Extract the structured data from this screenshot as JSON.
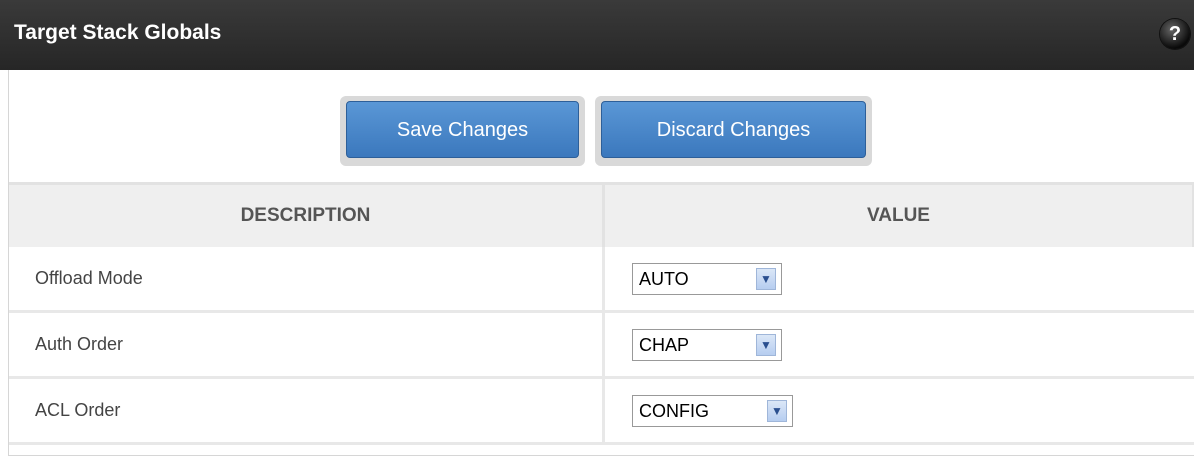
{
  "header": {
    "title": "Target Stack Globals",
    "help_icon": "question-mark-icon",
    "help_glyph": "?"
  },
  "toolbar": {
    "save_label": "Save Changes",
    "discard_label": "Discard Changes"
  },
  "table": {
    "columns": [
      "DESCRIPTION",
      "VALUE"
    ],
    "rows": [
      {
        "description": "Offload Mode",
        "value": "AUTO"
      },
      {
        "description": "Auth Order",
        "value": "CHAP"
      },
      {
        "description": "ACL Order",
        "value": "CONFIG"
      }
    ]
  },
  "colors": {
    "titlebar": "#2e2e2e",
    "button": "#4a88cb"
  }
}
